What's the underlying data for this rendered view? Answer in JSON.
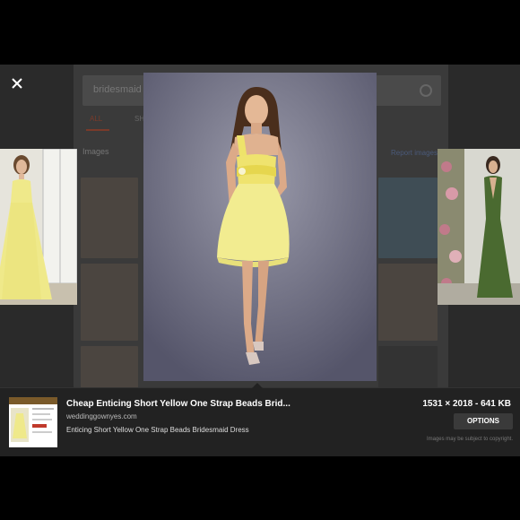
{
  "background_page": {
    "search_text": "bridesmaid dre",
    "tabs": [
      "ALL",
      "SHOP"
    ],
    "images_label": "Images",
    "report_link": "Report images"
  },
  "close_icon": "close-icon",
  "main_image": {
    "subject": "yellow one strap short dress"
  },
  "info_panel": {
    "title": "Cheap Enticing Short Yellow One Strap Beads Brid...",
    "domain": "weddinggownyes.com",
    "description": "Enticing Short Yellow One Strap Beads Bridesmaid Dress",
    "dimensions": "1531 × 2018 - 641 KB",
    "options_label": "OPTIONS",
    "copyright_note": "Images may be subject to copyright."
  },
  "colors": {
    "dress_yellow": "#efe98a",
    "backdrop": "#6a6a7a",
    "panel_bg": "#222222"
  }
}
